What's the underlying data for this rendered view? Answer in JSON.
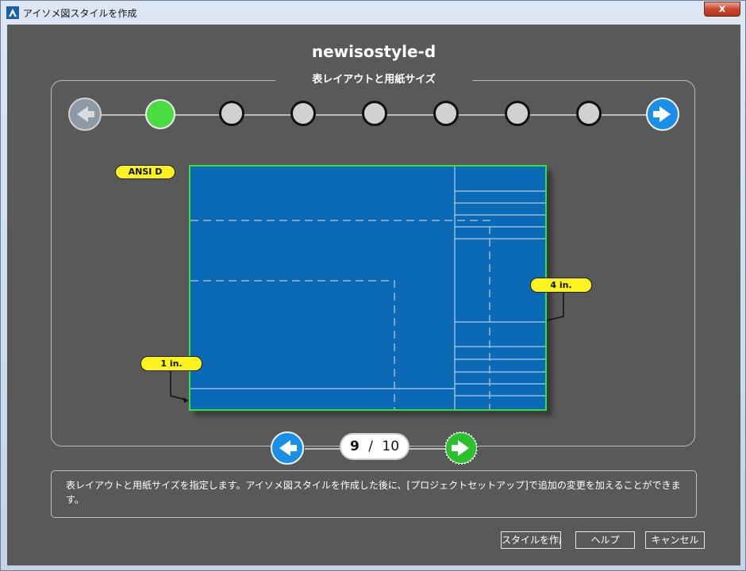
{
  "window": {
    "title": "アイソメ図スタイルを作成",
    "close_label": "x"
  },
  "wizard": {
    "style_name": "newisostyle-d",
    "section_title": "表レイアウトと用紙サイズ",
    "steps_total": 8,
    "active_step": 1
  },
  "preview": {
    "sheet_size_label": "ANSI D",
    "right_margin_label": "4 in.",
    "bottom_margin_label": "1 in."
  },
  "pager": {
    "current": "9",
    "separator": "/",
    "total": "10"
  },
  "description": "表レイアウトと用紙サイズを指定します。アイソメ図スタイルを作成した後に、[プロジェクトセットアップ]で追加の変更を加えることができます。",
  "buttons": {
    "create": "スタイルを作成",
    "help": "ヘルプ",
    "cancel": "キャンセル"
  },
  "colors": {
    "background": "#595959",
    "sheet": "#0b6ab6",
    "sheet_border": "#35e03a",
    "label": "#fff31f",
    "active_step": "#49dd41",
    "nav_blue": "#1a8fe8"
  },
  "icons": {
    "app": "autodesk-logo-icon",
    "step_back": "arrow-left-icon",
    "step_forward": "arrow-right-icon",
    "page_back": "arrow-left-icon",
    "page_forward": "arrow-right-icon"
  }
}
